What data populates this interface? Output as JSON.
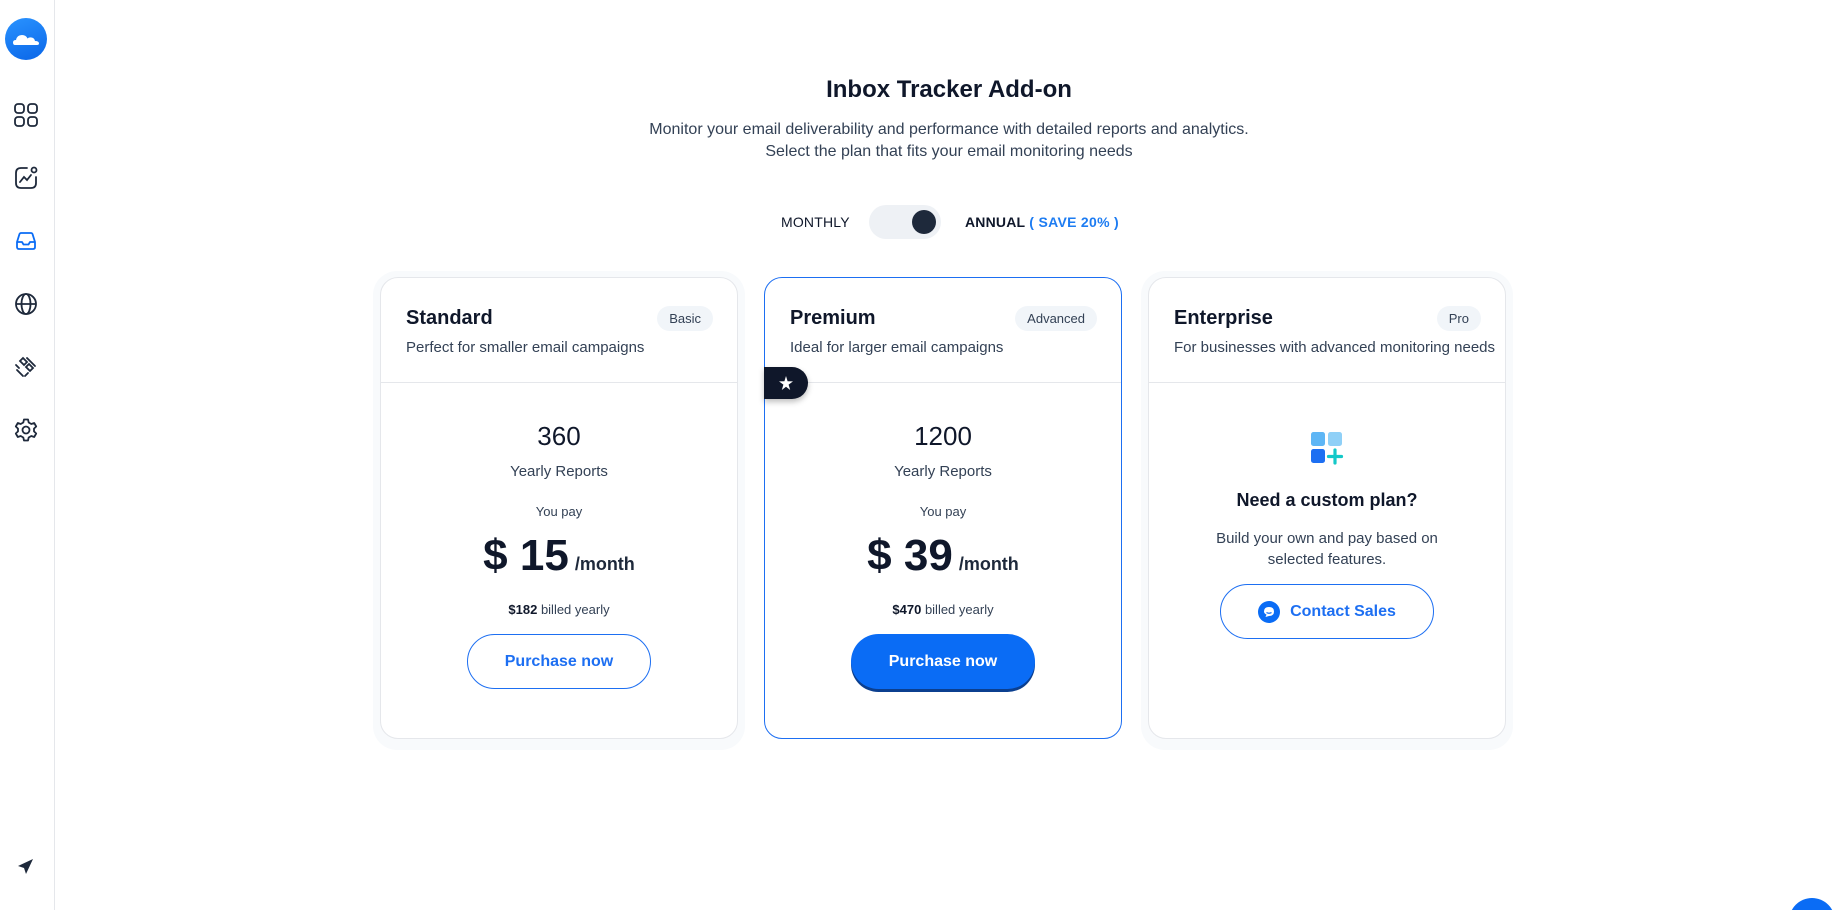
{
  "sidebar": {
    "items": [
      {
        "icon": "dashboard-icon"
      },
      {
        "icon": "analytics-icon"
      },
      {
        "icon": "inbox-icon",
        "active": true
      },
      {
        "icon": "globe-icon"
      },
      {
        "icon": "integrations-icon"
      },
      {
        "icon": "settings-icon"
      }
    ],
    "bottom_icon": "send-icon"
  },
  "header": {
    "title": "Inbox Tracker Add-on",
    "subtitle_line1": "Monitor your email deliverability and performance with detailed reports and analytics.",
    "subtitle_line2": "Select the plan that fits your email monitoring needs"
  },
  "billing_toggle": {
    "monthly_label": "MONTHLY",
    "annual_label": "ANNUAL",
    "save_label": "( SAVE 20% )",
    "selected": "annual"
  },
  "plans": [
    {
      "name": "Standard",
      "badge": "Basic",
      "description": "Perfect for smaller email campaigns",
      "count": "360",
      "count_label": "Yearly Reports",
      "you_pay": "You pay",
      "price": "$ 15",
      "period": "/month",
      "billed_amount": "$182",
      "billed_text": "billed yearly",
      "cta": "Purchase now"
    },
    {
      "name": "Premium",
      "badge": "Advanced",
      "description": "Ideal for larger email campaigns",
      "count": "1200",
      "count_label": "Yearly Reports",
      "you_pay": "You pay",
      "price": "$ 39",
      "period": "/month",
      "billed_amount": "$470",
      "billed_text": "billed yearly",
      "cta": "Purchase now",
      "featured": true
    },
    {
      "name": "Enterprise",
      "badge": "Pro",
      "description": "For businesses with advanced monitoring needs",
      "custom_title": "Need a custom plan?",
      "custom_desc": "Build your own and pay based on selected features.",
      "cta": "Contact Sales"
    }
  ],
  "colors": {
    "accent": "#0a6cf5",
    "dark": "#0f172a"
  }
}
